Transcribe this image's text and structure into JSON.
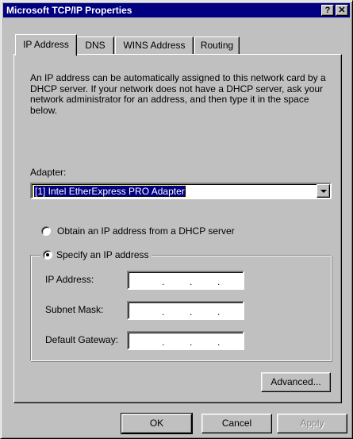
{
  "window": {
    "title": "Microsoft TCP/IP Properties",
    "help_glyph": "?",
    "close_glyph": "✕"
  },
  "tabs": [
    {
      "label": "IP Address",
      "active": true
    },
    {
      "label": "DNS",
      "active": false
    },
    {
      "label": "WINS Address",
      "active": false
    },
    {
      "label": "Routing",
      "active": false
    }
  ],
  "description": "An IP address can be automatically assigned to this network card by a DHCP server.  If your network does not have a DHCP server, ask your network administrator for an address, and then type it in the space below.",
  "adapter": {
    "label": "Adapter:",
    "selected": "[1] Intel EtherExpress PRO Adapter"
  },
  "options": {
    "obtain_dhcp": {
      "label": "Obtain an IP address from a DHCP server",
      "checked": false
    },
    "specify": {
      "label": "Specify an IP address",
      "checked": true
    }
  },
  "fields": {
    "ip_address": {
      "label": "IP Address:",
      "value": ""
    },
    "subnet_mask": {
      "label": "Subnet Mask:",
      "value": ""
    },
    "default_gateway": {
      "label": "Default Gateway:",
      "value": ""
    },
    "separator": "."
  },
  "buttons": {
    "advanced": "Advanced...",
    "ok": "OK",
    "cancel": "Cancel",
    "apply": "Apply"
  },
  "colors": {
    "titlebar": "#000080",
    "face": "#c0c0c0",
    "selection": "#000080"
  }
}
